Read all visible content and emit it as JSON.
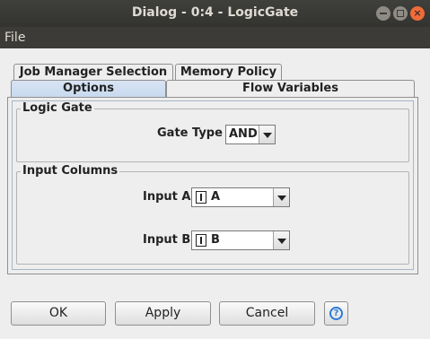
{
  "window": {
    "title": "Dialog - 0:4 - LogicGate",
    "controls": {
      "close_glyph": "×"
    }
  },
  "menubar": {
    "items": [
      {
        "label": "File"
      }
    ]
  },
  "tabs": {
    "row1": [
      {
        "label": "Job Manager Selection"
      },
      {
        "label": "Memory Policy"
      }
    ],
    "row2": [
      {
        "label": "Options",
        "selected": true
      },
      {
        "label": "Flow Variables",
        "selected": false
      }
    ]
  },
  "logic_gate": {
    "legend": "Logic Gate",
    "gate_type_label": "Gate Type",
    "gate_type_value": "AND"
  },
  "input_columns": {
    "legend": "Input Columns",
    "input_a_label": "Input A",
    "input_a_value": "A",
    "input_b_label": "Input B",
    "input_b_value": "B"
  },
  "buttons": {
    "ok": "OK",
    "apply": "Apply",
    "cancel": "Cancel",
    "help_glyph": "?"
  },
  "colors": {
    "title_bar": "#3c3b37",
    "close_button": "#ef6b3a",
    "selected_tab": "#c7d9ef",
    "help_icon": "#2d7ad6"
  }
}
